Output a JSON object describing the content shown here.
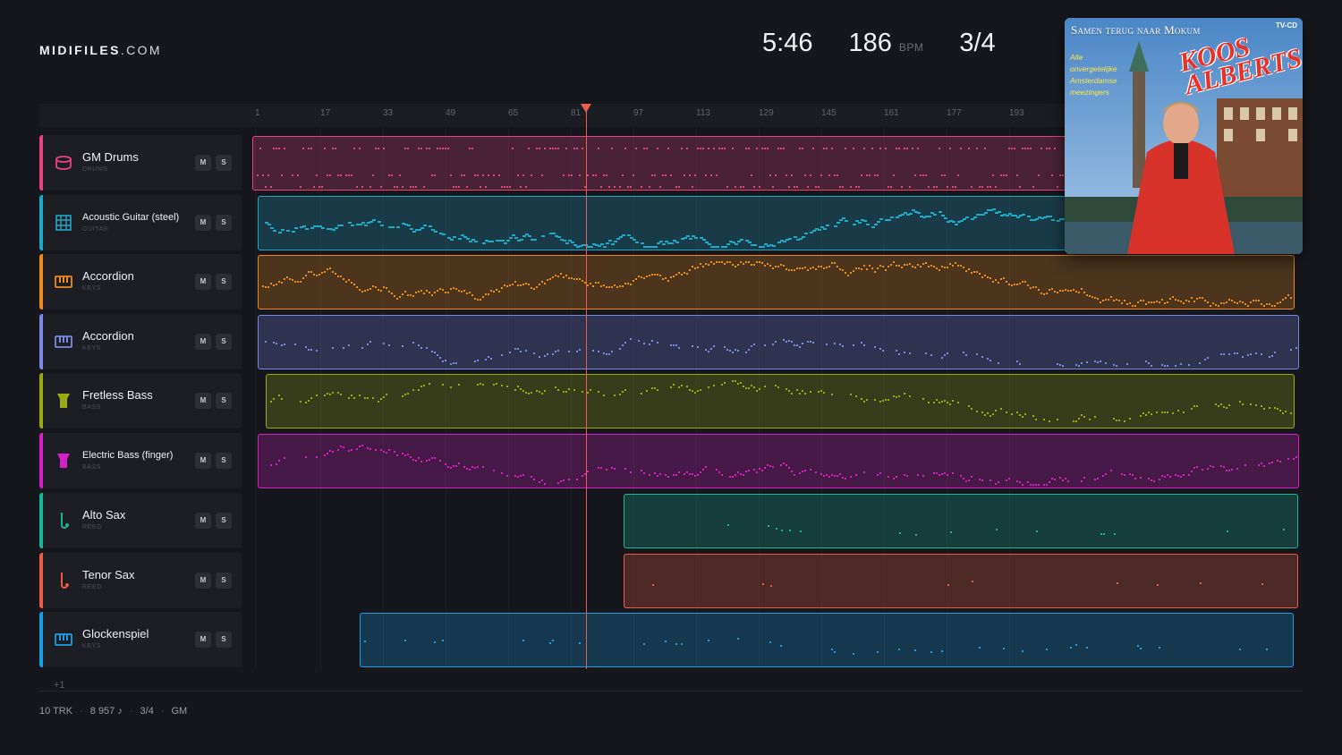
{
  "brand": {
    "bold": "MIDIFILES",
    "light": ".COM"
  },
  "stats": {
    "duration": "5:46",
    "tempo": "186",
    "tempo_unit": "BPM",
    "time_signature": "3/4"
  },
  "ruler": {
    "ticks": [
      "1",
      "17",
      "33",
      "49",
      "65",
      "81",
      "97",
      "113",
      "129",
      "145",
      "161",
      "177",
      "193"
    ]
  },
  "playhead": {
    "position_label": "81"
  },
  "tracks": [
    {
      "name": "GM Drums",
      "category": "DRUMS",
      "color": "#e8457f",
      "icon": "drum-icon",
      "mute": "M",
      "solo": "S"
    },
    {
      "name": "Acoustic Guitar (steel)",
      "category": "GUITAR",
      "color": "#1ea9c9",
      "icon": "guitar-icon",
      "mute": "M",
      "solo": "S"
    },
    {
      "name": "Accordion",
      "category": "KEYS",
      "color": "#ef8a1e",
      "icon": "keys-icon",
      "mute": "M",
      "solo": "S"
    },
    {
      "name": "Accordion",
      "category": "KEYS",
      "color": "#7b89e6",
      "icon": "keys-icon",
      "mute": "M",
      "solo": "S"
    },
    {
      "name": "Fretless Bass",
      "category": "BASS",
      "color": "#9aab12",
      "icon": "bass-icon",
      "mute": "M",
      "solo": "S"
    },
    {
      "name": "Electric Bass (finger)",
      "category": "BASS",
      "color": "#d61fc8",
      "icon": "bass-icon",
      "mute": "M",
      "solo": "S"
    },
    {
      "name": "Alto Sax",
      "category": "REED",
      "color": "#17b89a",
      "icon": "sax-icon",
      "mute": "M",
      "solo": "S"
    },
    {
      "name": "Tenor Sax",
      "category": "REED",
      "color": "#ee5a44",
      "icon": "sax-icon",
      "mute": "M",
      "solo": "S"
    },
    {
      "name": "Glockenspiel",
      "category": "KEYS",
      "color": "#1a9ee6",
      "icon": "keys-icon",
      "mute": "M",
      "solo": "S"
    }
  ],
  "more_tracks": "+1",
  "footer": {
    "tracks": "10 TRK",
    "notes": "8 957 ♪",
    "time_signature": "3/4",
    "standard": "GM"
  },
  "album": {
    "title": "Samen terug naar Mokum",
    "badge": "TV-CD",
    "artist_line1": "KOOS",
    "artist_line2": "ALBERTS",
    "tagline": "Alle onvergetelijke Amsterdamse meezingers"
  }
}
